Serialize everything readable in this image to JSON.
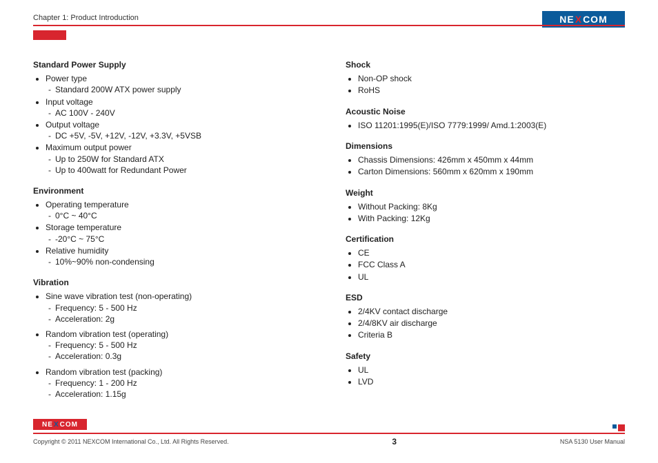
{
  "header": {
    "chapter": "Chapter 1: Product Introduction",
    "brand_pre": "NE",
    "brand_x": "X",
    "brand_post": "COM"
  },
  "left": {
    "power": {
      "title": "Standard Power Supply",
      "i1": "Power type",
      "i1a": "Standard 200W ATX power supply",
      "i2": "Input voltage",
      "i2a": "AC 100V - 240V",
      "i3": "Output voltage",
      "i3a": "DC +5V, -5V, +12V, -12V, +3.3V, +5VSB",
      "i4": "Maximum output power",
      "i4a": "Up to 250W for Standard ATX",
      "i4b": "Up to 400watt for Redundant Power"
    },
    "env": {
      "title": "Environment",
      "i1": "Operating temperature",
      "i1a": "0°C ~ 40°C",
      "i2": "Storage temperature",
      "i2a": "-20°C ~ 75°C",
      "i3": "Relative humidity",
      "i3a": "10%~90% non-condensing"
    },
    "vib": {
      "title": "Vibration",
      "i1": "Sine wave vibration test (non-operating)",
      "i1a": "Frequency: 5 - 500 Hz",
      "i1b": "Acceleration: 2g",
      "i2": "Random vibration test (operating)",
      "i2a": "Frequency: 5 - 500 Hz",
      "i2b": "Acceleration: 0.3g",
      "i3": "Random vibration test (packing)",
      "i3a": "Frequency: 1 - 200 Hz",
      "i3b": "Acceleration: 1.15g"
    }
  },
  "right": {
    "shock": {
      "title": "Shock",
      "i1": "Non-OP shock",
      "i2": "RoHS"
    },
    "noise": {
      "title": "Acoustic Noise",
      "i1": "ISO 11201:1995(E)/ISO 7779:1999/ Amd.1:2003(E)"
    },
    "dim": {
      "title": "Dimensions",
      "i1": "Chassis Dimensions: 426mm x 450mm x 44mm",
      "i2": "Carton Dimensions: 560mm x 620mm x 190mm"
    },
    "weight": {
      "title": "Weight",
      "i1": "Without Packing: 8Kg",
      "i2": "With Packing: 12Kg"
    },
    "cert": {
      "title": "Certification",
      "i1": "CE",
      "i2": "FCC Class A",
      "i3": "UL"
    },
    "esd": {
      "title": "ESD",
      "i1": "2/4KV contact discharge",
      "i2": "2/4/8KV air discharge",
      "i3": "Criteria B"
    },
    "safety": {
      "title": "Safety",
      "i1": "UL",
      "i2": "LVD"
    }
  },
  "footer": {
    "copyright": "Copyright © 2011 NEXCOM International Co., Ltd. All Rights Reserved.",
    "page": "3",
    "doc": "NSA 5130 User Manual"
  }
}
